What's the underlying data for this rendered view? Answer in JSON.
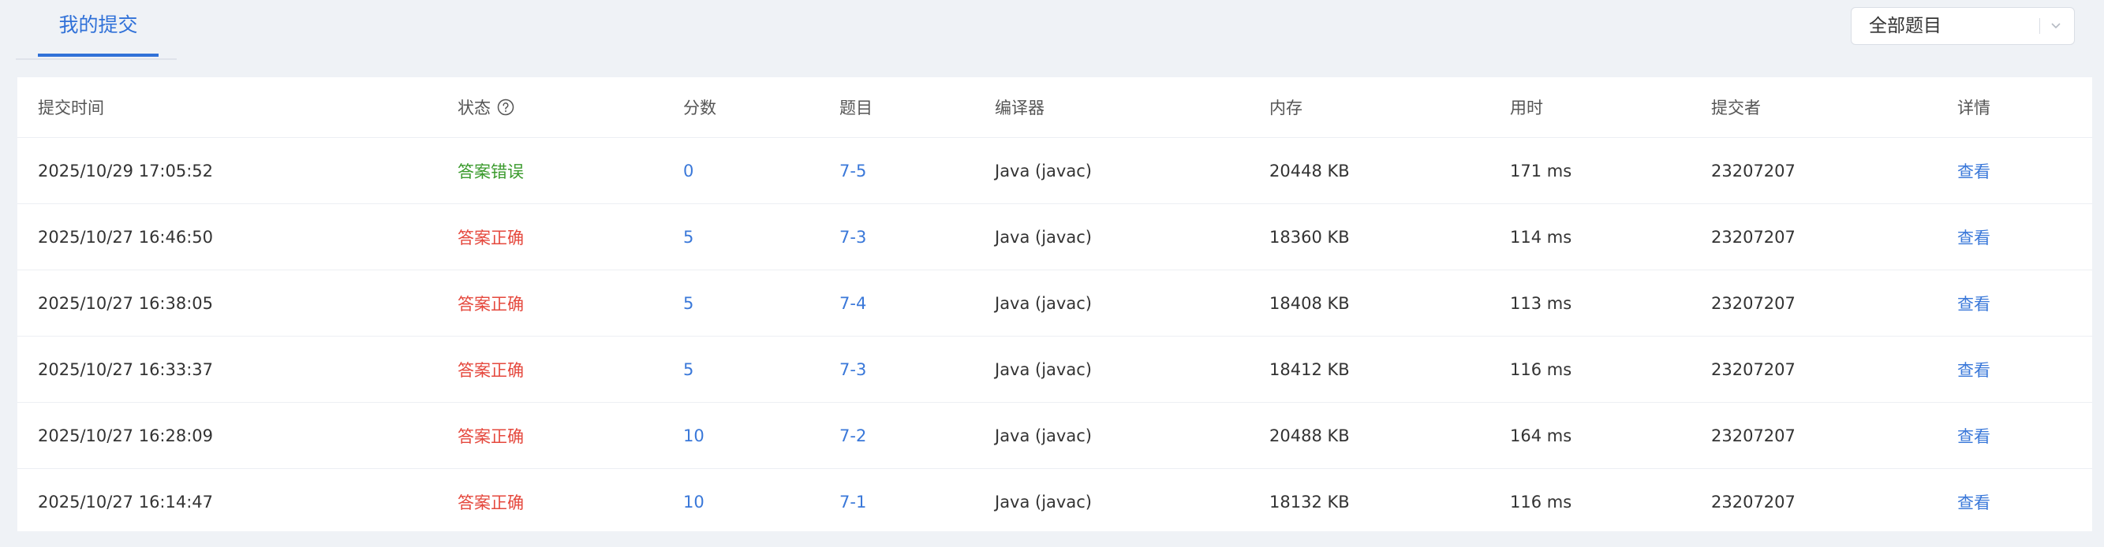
{
  "tabs": {
    "active": "我的提交"
  },
  "filter": {
    "selected": "全部题目"
  },
  "table": {
    "headers": [
      "提交时间",
      "状态",
      "分数",
      "题目",
      "编译器",
      "内存",
      "用时",
      "提交者",
      "详情"
    ],
    "rows": [
      {
        "time": "2025/10/29 17:05:52",
        "status": "答案错误",
        "status_kind": "wrong",
        "score": "0",
        "problem": "7-5",
        "compiler": "Java (javac)",
        "memory": "20448 KB",
        "duration": "171 ms",
        "submitter": "23207207",
        "detail": "查看"
      },
      {
        "time": "2025/10/27 16:46:50",
        "status": "答案正确",
        "status_kind": "right",
        "score": "5",
        "problem": "7-3",
        "compiler": "Java (javac)",
        "memory": "18360 KB",
        "duration": "114 ms",
        "submitter": "23207207",
        "detail": "查看"
      },
      {
        "time": "2025/10/27 16:38:05",
        "status": "答案正确",
        "status_kind": "right",
        "score": "5",
        "problem": "7-4",
        "compiler": "Java (javac)",
        "memory": "18408 KB",
        "duration": "113 ms",
        "submitter": "23207207",
        "detail": "查看"
      },
      {
        "time": "2025/10/27 16:33:37",
        "status": "答案正确",
        "status_kind": "right",
        "score": "5",
        "problem": "7-3",
        "compiler": "Java (javac)",
        "memory": "18412 KB",
        "duration": "116 ms",
        "submitter": "23207207",
        "detail": "查看"
      },
      {
        "time": "2025/10/27 16:28:09",
        "status": "答案正确",
        "status_kind": "right",
        "score": "10",
        "problem": "7-2",
        "compiler": "Java (javac)",
        "memory": "20488 KB",
        "duration": "164 ms",
        "submitter": "23207207",
        "detail": "查看"
      },
      {
        "time": "2025/10/27 16:14:47",
        "status": "答案正确",
        "status_kind": "right",
        "score": "10",
        "problem": "7-1",
        "compiler": "Java (javac)",
        "memory": "18132 KB",
        "duration": "116 ms",
        "submitter": "23207207",
        "detail": "查看"
      }
    ]
  },
  "colors": {
    "accent": "#3071d8",
    "link": "#3a78d9",
    "wrong": "#3a9a2c",
    "right": "#e5483d",
    "background": "#eff2f6"
  },
  "icons": {
    "status_help": "question-circle-icon",
    "dropdown": "chevron-down-icon"
  }
}
